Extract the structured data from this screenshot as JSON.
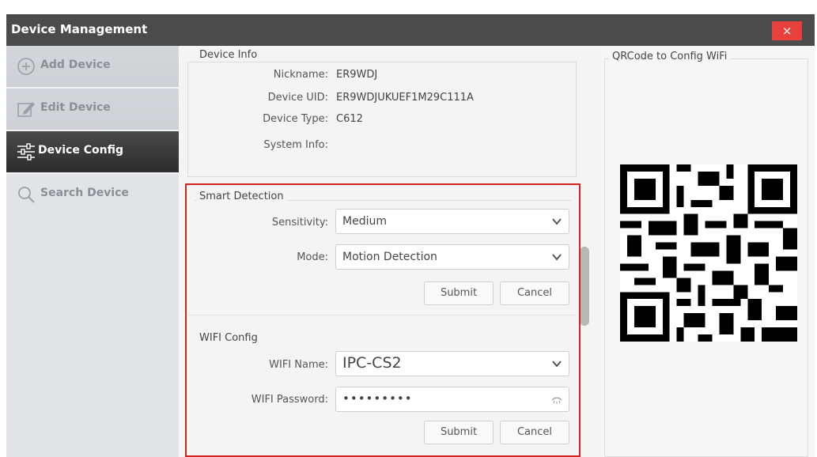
{
  "window": {
    "title": "Device Management",
    "close_label": "×"
  },
  "sidebar": {
    "items": [
      {
        "label": "Add Device",
        "icon": "plus-circle-icon",
        "active": false
      },
      {
        "label": "Edit Device",
        "icon": "edit-icon",
        "active": false
      },
      {
        "label": "Device Config",
        "icon": "sliders-icon",
        "active": true
      },
      {
        "label": "Search Device",
        "icon": "search-icon",
        "active": false
      }
    ]
  },
  "device_info": {
    "legend": "Device Info",
    "nickname_label": "Nickname:",
    "nickname": "ER9WDJ",
    "uid_label": "Device UID:",
    "uid": "ER9WDJUKUEF1M29C111A",
    "type_label": "Device Type:",
    "type": "C612",
    "sysinfo_label": "System Info:"
  },
  "smart_detection": {
    "legend": "Smart Detection",
    "sensitivity_label": "Sensitivity:",
    "sensitivity": "Medium",
    "mode_label": "Mode:",
    "mode": "Motion Detection",
    "submit": "Submit",
    "cancel": "Cancel"
  },
  "wifi_config": {
    "legend": "WIFI Config",
    "name_label": "WIFI Name:",
    "name": "IPC-CS2",
    "password_label": "WIFI Password:",
    "password": "•••••••••",
    "submit": "Submit",
    "cancel": "Cancel"
  },
  "qr_panel": {
    "legend": "QRCode to Config WiFi"
  },
  "colors": {
    "highlight_border": "#d2231f",
    "titlebar": "#4b4b4b",
    "close": "#e8403c"
  }
}
